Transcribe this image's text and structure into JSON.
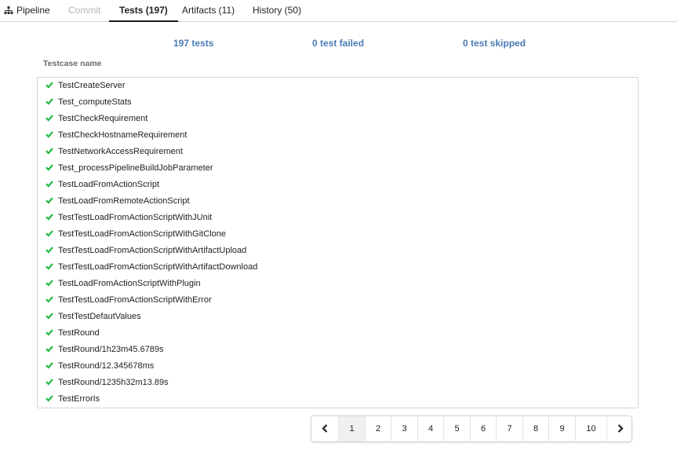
{
  "tabs": [
    {
      "label": "Pipeline",
      "state": "normal"
    },
    {
      "label": "Commit",
      "state": "disabled"
    },
    {
      "label": "Tests (197)",
      "state": "active"
    },
    {
      "label": "Artifacts (11)",
      "state": "normal"
    },
    {
      "label": "History (50)",
      "state": "normal"
    }
  ],
  "summary": {
    "total": "197 tests",
    "failed": "0 test failed",
    "skipped": "0 test skipped"
  },
  "table": {
    "header": "Testcase name",
    "rows": [
      "TestCreateServer",
      "Test_computeStats",
      "TestCheckRequirement",
      "TestCheckHostnameRequirement",
      "TestNetworkAccessRequirement",
      "Test_processPipelineBuildJobParameter",
      "TestLoadFromActionScript",
      "TestLoadFromRemoteActionScript",
      "TestTestLoadFromActionScriptWithJUnit",
      "TestTestLoadFromActionScriptWithGitClone",
      "TestTestLoadFromActionScriptWithArtifactUpload",
      "TestTestLoadFromActionScriptWithArtifactDownload",
      "TestLoadFromActionScriptWithPlugin",
      "TestTestLoadFromActionScriptWithError",
      "TestTestDefautValues",
      "TestRound",
      "TestRound/1h23m45.6789s",
      "TestRound/12.345678ms",
      "TestRound/1235h32m13.89s",
      "TestErrorIs"
    ],
    "status_icon": "check-icon",
    "status_color": "#21ba45"
  },
  "pagination": {
    "prev_icon": "chevron-left-icon",
    "next_icon": "chevron-right-icon",
    "pages": [
      "1",
      "2",
      "3",
      "4",
      "5",
      "6",
      "7",
      "8",
      "9",
      "10"
    ],
    "current": "1"
  },
  "colors": {
    "link": "#4a7bb5",
    "success": "#21ba45",
    "border": "#d4d4d5"
  }
}
